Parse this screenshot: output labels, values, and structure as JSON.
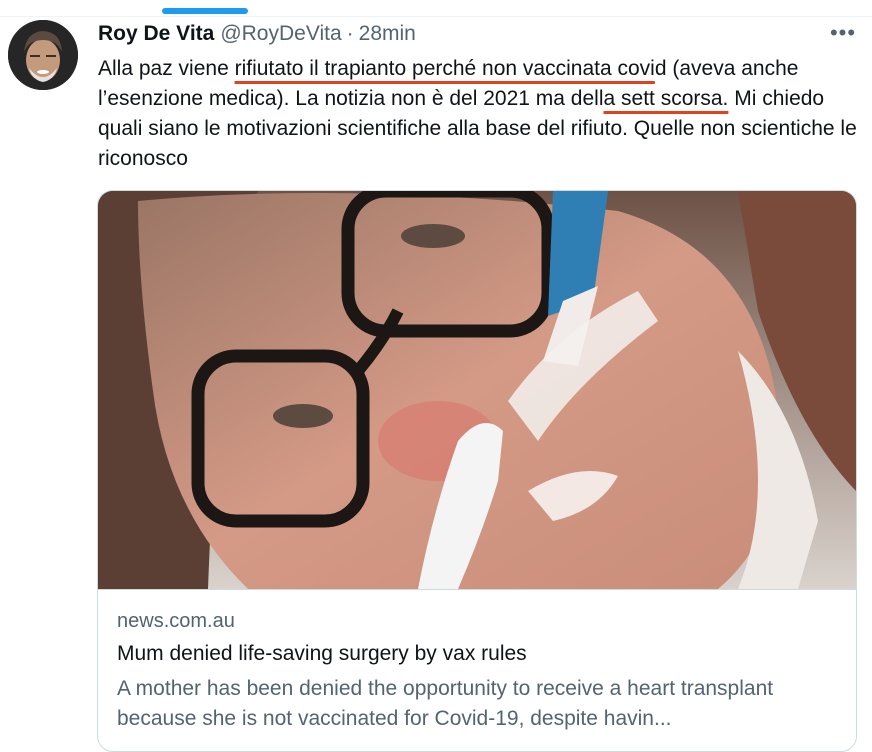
{
  "tweet": {
    "author_name": "Roy De Vita",
    "author_handle": "@RoyDeVita",
    "separator": "·",
    "time": "28min",
    "more_icon": "ellipsis-icon",
    "text": {
      "part1": "Alla paz viene ",
      "underline1": "rifiutato il trapianto perché non vaccinata covi",
      "part2": "d (aveva anche l’esenzione medica). La notizia non è del 2021 ma dell",
      "underline2": "a sett scorsa.",
      "part3": " Mi chiedo quali siano le motivazioni scientifiche alla base del rifiuto. Quelle non scientiche le riconosco"
    },
    "underline_color": "#e0421d"
  },
  "card": {
    "domain": "news.com.au",
    "title": "Mum denied life-saving surgery by vax rules",
    "description": "A mother has been denied the opportunity to receive a heart transplant because she is not vaccinated for Covid-19, despite havin..."
  },
  "colors": {
    "accent": "#1d9bf0",
    "text_primary": "#0f1419",
    "text_secondary": "#536471",
    "border": "#cfd9de"
  }
}
